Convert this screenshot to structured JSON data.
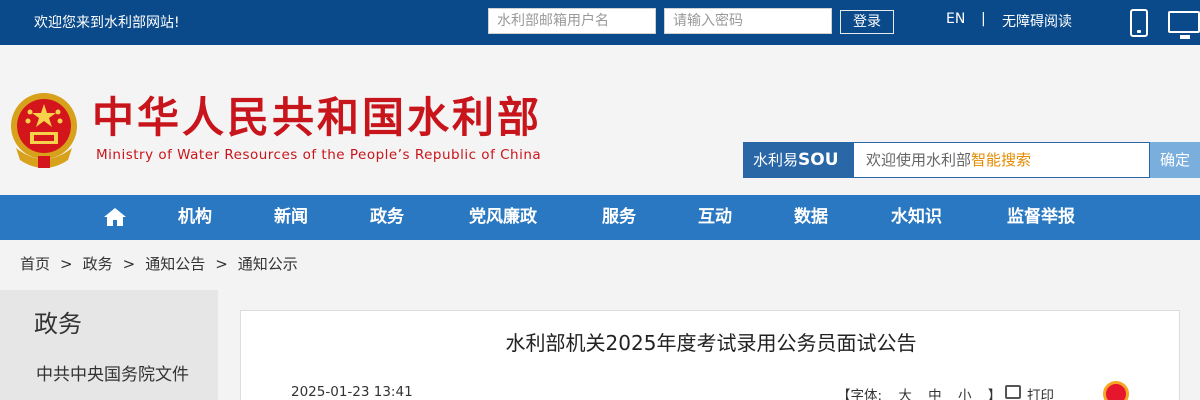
{
  "topbar": {
    "welcome": "欢迎您来到水利部网站!",
    "username_placeholder": "水利部邮箱用户名",
    "password_placeholder": "请输入密码",
    "login_label": "登录",
    "lang_en": "EN",
    "lang_sep": "|",
    "accessible_label": "无障碍阅读"
  },
  "header": {
    "title": "中华人民共和国水利部",
    "subtitle": "Ministry of Water Resources of the People’s Republic of China",
    "search_logo_text": "水利易",
    "search_logo_bold": "SOU",
    "search_placeholder_prefix": "欢迎使用水利部",
    "search_placeholder_highlight": "智能搜索",
    "search_button": "确定"
  },
  "nav": {
    "items": [
      "机构",
      "新闻",
      "政务",
      "党风廉政",
      "服务",
      "互动",
      "数据",
      "水知识",
      "监督举报"
    ]
  },
  "breadcrumb": {
    "items": [
      "首页",
      "政务",
      "通知公告",
      "通知公示"
    ],
    "separator": ">"
  },
  "sidebar": {
    "title": "政务",
    "items": [
      "中共中央国务院文件"
    ]
  },
  "article": {
    "title": "水利部机关2025年度考试录用公务员面试公告",
    "date": "2025-01-23 13:41",
    "font_label": "【字体:",
    "font_large": "大",
    "font_medium": "中",
    "font_small": "小",
    "font_close": "】",
    "print_label": "打印"
  },
  "colors": {
    "topbar_bg": "#0a4a8a",
    "nav_bg": "#2a78c2",
    "title_red": "#c8151b",
    "search_highlight": "#e58b00"
  },
  "icons": [
    "home-icon",
    "phone-icon",
    "monitor-icon",
    "print-icon",
    "weibo-icon",
    "national-emblem-icon",
    "search-magnifier-icon"
  ]
}
